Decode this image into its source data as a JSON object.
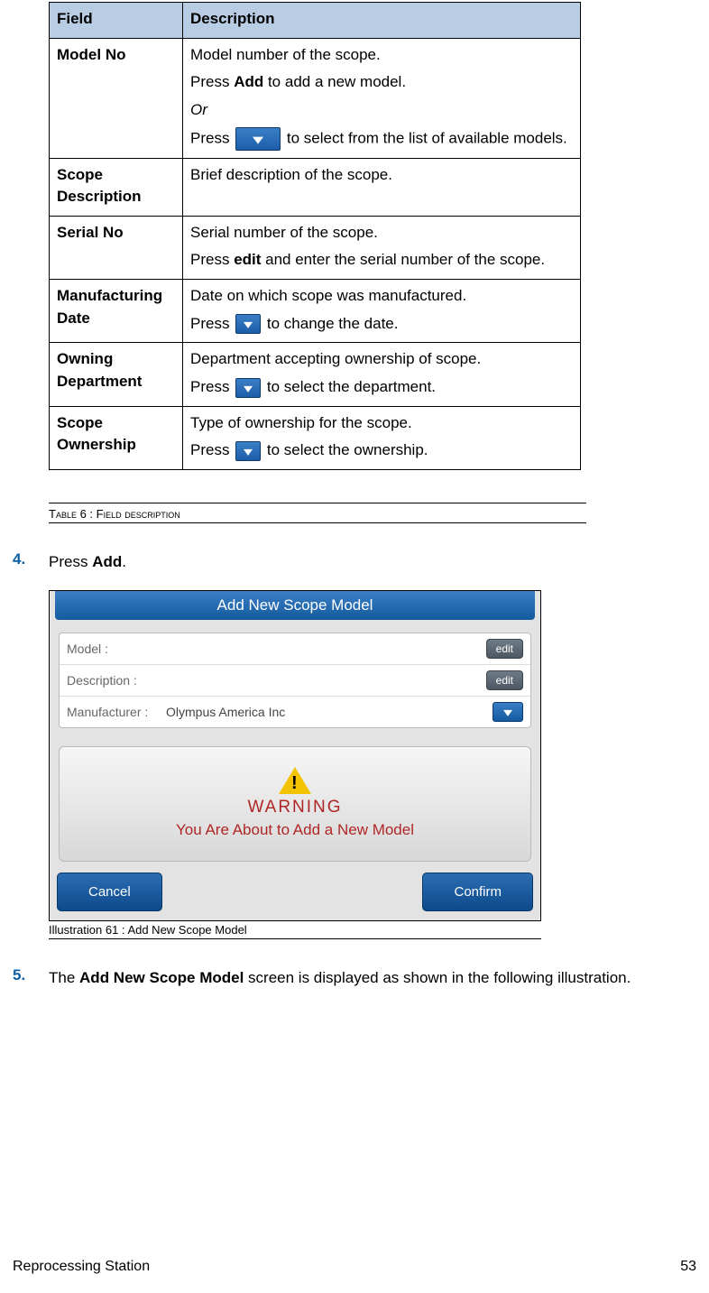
{
  "table": {
    "head": {
      "field": "Field",
      "desc": "Description"
    },
    "rows": {
      "modelNo": {
        "field": "Model No",
        "p1": "Model number of the scope.",
        "p2a": "Press ",
        "p2b": "Add",
        "p2c": " to add a new model.",
        "p3": "Or",
        "p4a": "Press ",
        "p4b": " to select from the list of available models."
      },
      "scopeDesc": {
        "field": "Scope Description",
        "p1": "Brief description of the scope."
      },
      "serialNo": {
        "field": "Serial No",
        "p1": "Serial number of the scope.",
        "p2a": "Press ",
        "p2b": "edit",
        "p2c": " and enter the serial number of the scope."
      },
      "mfgDate": {
        "field": "Manufacturing Date",
        "p1": "Date on which scope was manufactured.",
        "p2a": "Press ",
        "p2b": " to change the date."
      },
      "ownDept": {
        "field": "Owning Department",
        "p1": "Department accepting ownership of scope.",
        "p2a": "Press ",
        "p2b": " to select the department."
      },
      "scopeOwn": {
        "field": "Scope Ownership",
        "p1": "Type of ownership for the scope.",
        "p2a": "Press ",
        "p2b": " to select the ownership."
      }
    }
  },
  "tableCaption": {
    "pre": "Table 6 :",
    "rest": "  Field description"
  },
  "step4": {
    "num": "4.",
    "a": "Press ",
    "b": "Add",
    "c": "."
  },
  "dialog": {
    "title": "Add New Scope Model",
    "modelLbl": "Model :",
    "descLbl": "Description :",
    "mfrLbl": "Manufacturer :",
    "mfrVal": "Olympus America Inc",
    "editBtn": "edit",
    "warnTitle": "WARNING",
    "warnMsg": "You Are About to Add a New Model",
    "cancel": "Cancel",
    "confirm": "Confirm"
  },
  "figCaption": {
    "pre": "Illustration 61 :",
    "rest": " Add New Scope Model"
  },
  "step5": {
    "num": "5.",
    "a": "The ",
    "b": "Add New Scope Model",
    "c": " screen is displayed as shown in the following illustration."
  },
  "footer": {
    "left": "Reprocessing Station",
    "right": "53"
  }
}
